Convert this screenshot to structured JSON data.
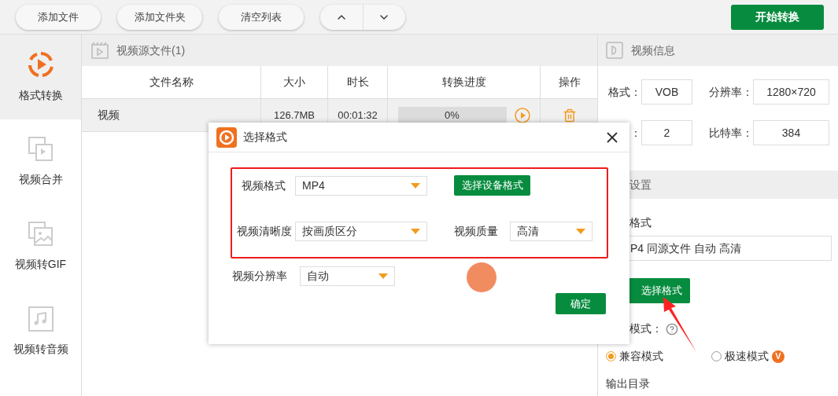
{
  "toolbar": {
    "buttons": [
      "添加文件",
      "添加文件夹",
      "清空列表"
    ],
    "start_button": "开始转换"
  },
  "sidebar": {
    "items": [
      {
        "label": "格式转换",
        "selected": true
      },
      {
        "label": "视频合并",
        "selected": false
      },
      {
        "label": "视频转GIF",
        "selected": false
      },
      {
        "label": "视频转音频",
        "selected": false
      }
    ]
  },
  "file_panel": {
    "title": "视频源文件(1)",
    "columns": [
      "文件名称",
      "大小",
      "时长",
      "转换进度",
      "操作"
    ],
    "rows": [
      {
        "name": "视频",
        "size": "126.7MB",
        "duration": "00:01:32",
        "progress": "0%",
        "level": 0
      }
    ]
  },
  "info_panel": {
    "title": "视频信息",
    "fields": [
      {
        "label": "格式：",
        "value": "VOB"
      },
      {
        "label": "分辨率：",
        "value": "1280×720"
      },
      {
        "label": "：",
        "value": "2"
      },
      {
        "label": "比特率：",
        "value": "384"
      }
    ]
  },
  "settings_panel": {
    "title": "设置",
    "format_label": "格式",
    "format_value": "P4 同源文件 自动 高清",
    "choose_button": "选择格式",
    "mode_label": "模式：",
    "modes": [
      {
        "label": "兼容模式",
        "selected": true
      },
      {
        "label": "极速模式",
        "selected": false,
        "badge": "V"
      }
    ],
    "output_label": "输出目录"
  },
  "dialog": {
    "title": "选择格式",
    "fields": [
      {
        "label": "视频格式",
        "value": "MP4"
      },
      {
        "label": "视频清晰度",
        "value": "按画质区分"
      },
      {
        "label": "视频质量",
        "value": "高清"
      },
      {
        "label": "视频分辨率",
        "value": "自动"
      }
    ],
    "device_button": "选择设备格式",
    "confirm_button": "确定"
  }
}
